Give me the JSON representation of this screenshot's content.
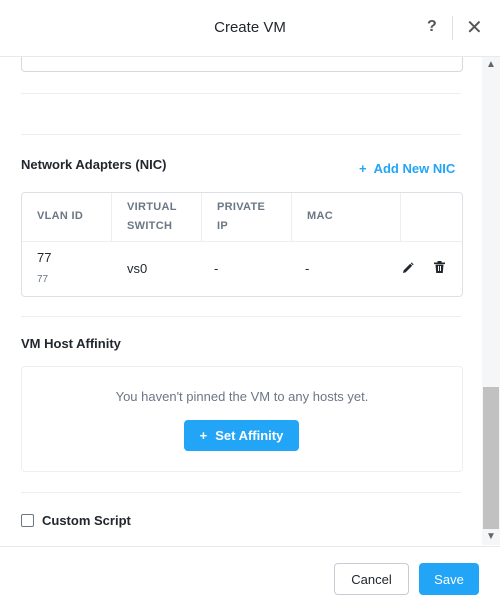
{
  "dialog": {
    "title": "Create VM",
    "help_label": "?",
    "close_label": "✕"
  },
  "nic": {
    "section_title": "Network Adapters (NIC)",
    "add_plus": "+",
    "add_label": "Add New NIC",
    "columns": [
      {
        "line1": "VLAN ID",
        "line2": ""
      },
      {
        "line1": "VIRTUAL",
        "line2": "SWITCH"
      },
      {
        "line1": "PRIVATE",
        "line2": "IP"
      },
      {
        "line1": "MAC",
        "line2": ""
      }
    ],
    "rows": [
      {
        "vlan_id": "77",
        "vlan_sub": "77",
        "virtual_switch": "vs0",
        "private_ip": "-",
        "mac": "-",
        "edit_icon": "pencil-icon",
        "delete_icon": "trash-icon"
      }
    ]
  },
  "affinity": {
    "section_title": "VM Host Affinity",
    "empty_message": "You haven't pinned the VM to any hosts yet.",
    "button_plus": "+",
    "button_label": "Set Affinity"
  },
  "custom_script": {
    "label": "Custom Script",
    "checked": false
  },
  "footer": {
    "cancel_label": "Cancel",
    "save_label": "Save"
  },
  "colors": {
    "accent": "#22a5f7",
    "text": "#22272e",
    "muted": "#6b7785"
  }
}
